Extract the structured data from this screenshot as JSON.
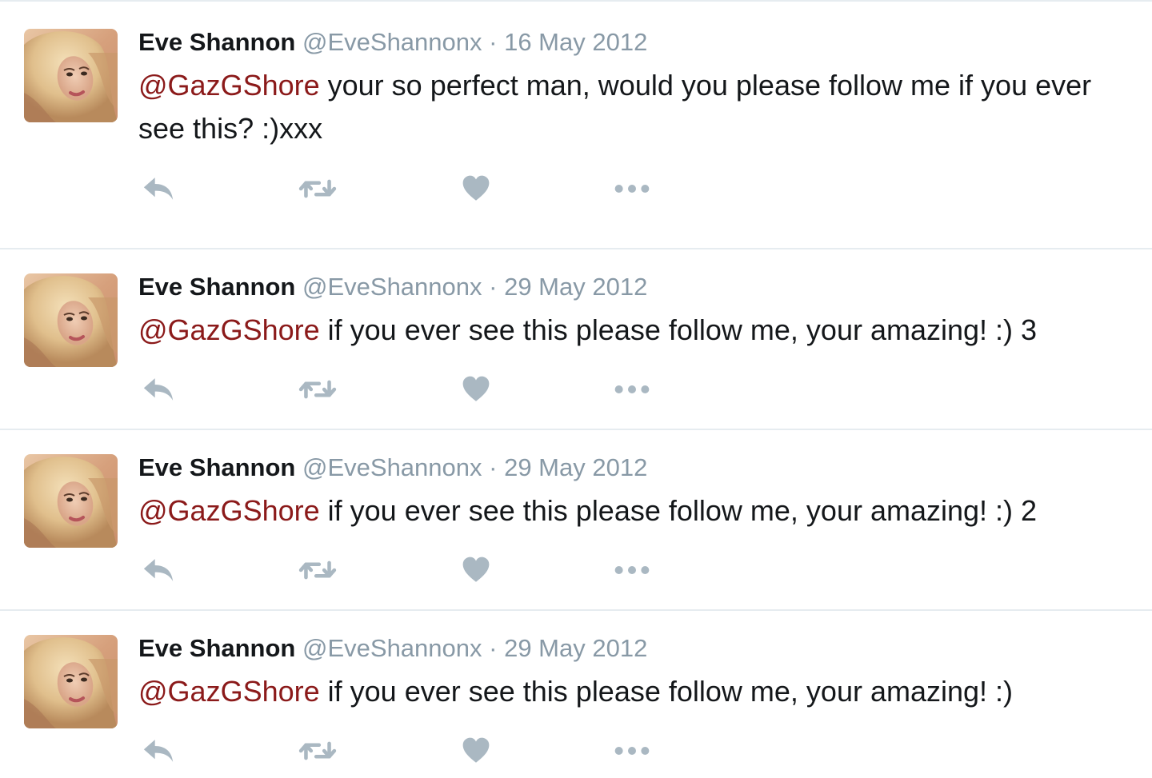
{
  "tweets": [
    {
      "name": "Eve Shannon",
      "handle": "@EveShannonx",
      "separator": " · ",
      "date": "16 May 2012",
      "mention": "@GazGShore",
      "text": " your so perfect man, would you please follow me if you ever see this? :)xxx"
    },
    {
      "name": "Eve Shannon",
      "handle": "@EveShannonx",
      "separator": " · ",
      "date": "29 May 2012",
      "mention": "@GazGShore",
      "text": " if you ever see this please follow me, your amazing! :) 3"
    },
    {
      "name": "Eve Shannon",
      "handle": "@EveShannonx",
      "separator": " · ",
      "date": "29 May 2012",
      "mention": "@GazGShore",
      "text": " if you ever see this please follow me, your amazing! :) 2"
    },
    {
      "name": "Eve Shannon",
      "handle": "@EveShannonx",
      "separator": " · ",
      "date": "29 May 2012",
      "mention": "@GazGShore",
      "text": " if you ever see this please follow me, your amazing! :)"
    }
  ],
  "actions": {
    "reply_icon": "reply-icon",
    "retweet_icon": "retweet-icon",
    "like_icon": "heart-icon",
    "more_icon": "more-dots-icon"
  },
  "colors": {
    "name": "#14171a",
    "meta": "#8899a6",
    "mention": "#8b1a1a",
    "icon": "#aab8c2",
    "divider": "#e6ecf0"
  }
}
